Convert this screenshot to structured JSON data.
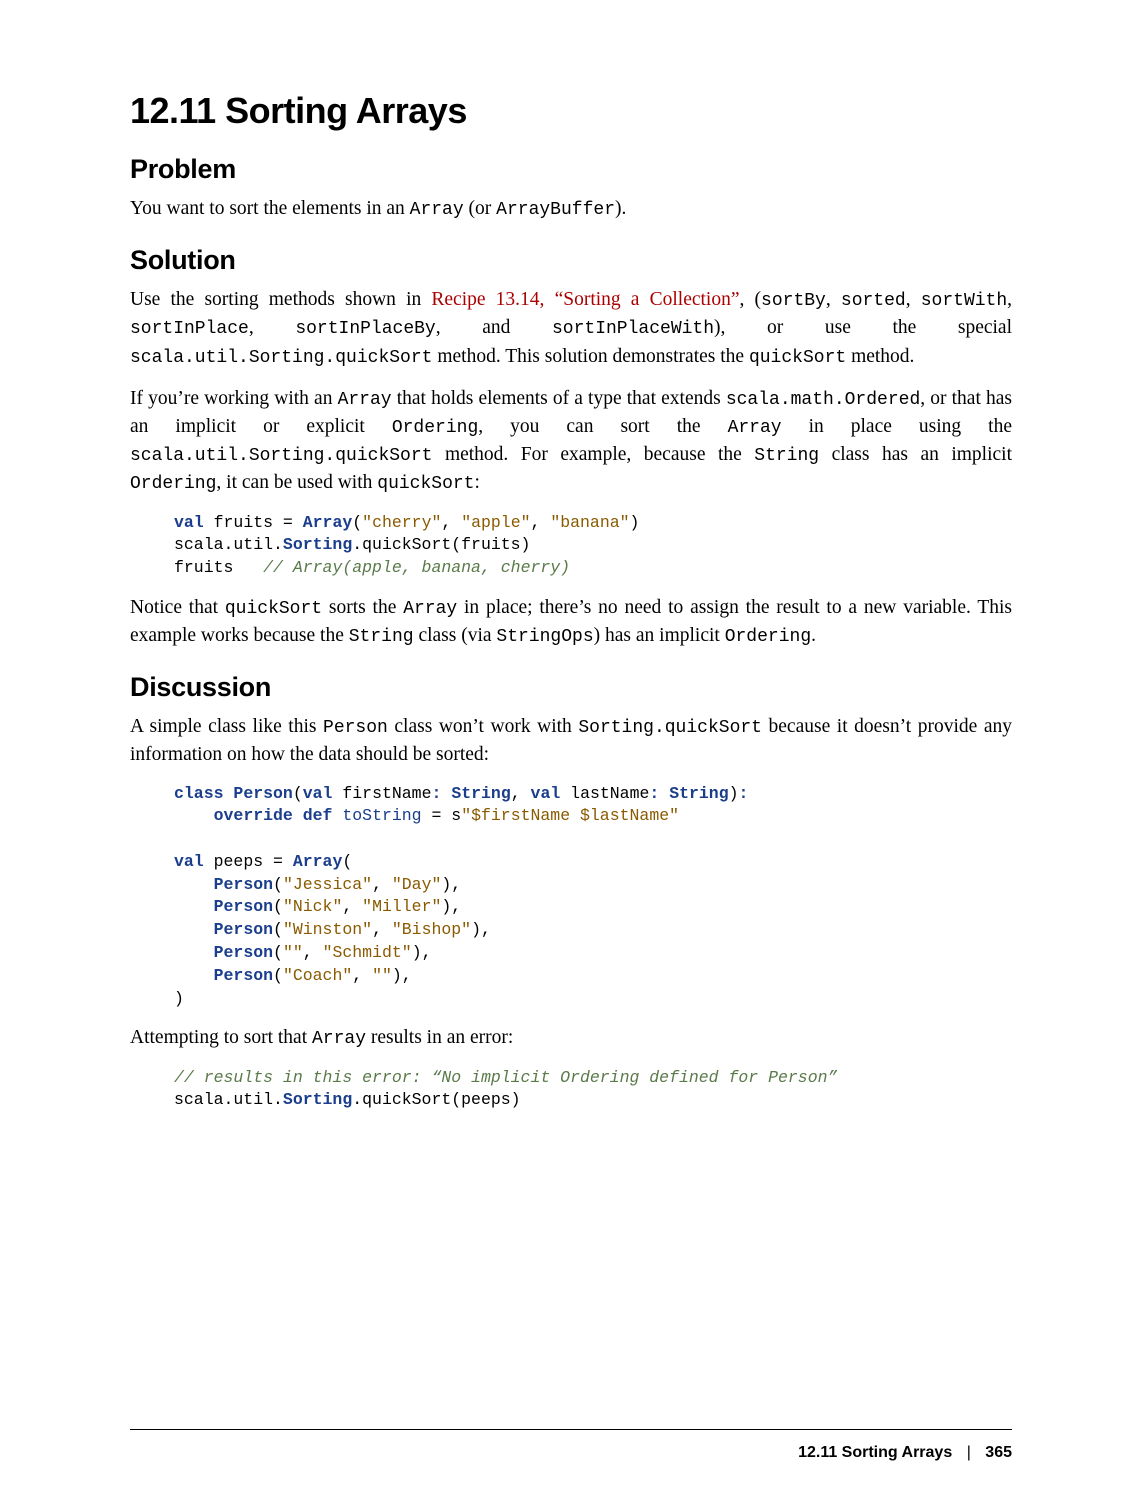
{
  "title": "12.11 Sorting Arrays",
  "sections": {
    "problem": {
      "heading": "Problem",
      "p1_a": "You want to sort the elements in an ",
      "p1_c1": "Array",
      "p1_b": " (or ",
      "p1_c2": "ArrayBuffer",
      "p1_c": ")."
    },
    "solution": {
      "heading": "Solution",
      "p1_a": "Use the sorting methods shown in ",
      "p1_link": "Recipe 13.14, “Sorting a Collection”",
      "p1_b": ", (",
      "p1_c1": "sortBy",
      "p1_c": ", ",
      "p1_c2": "sor",
      "p1_c2b": "ted",
      "p1_d": ", ",
      "p1_c3": "sortWith",
      "p1_e": ", ",
      "p1_c4": "sortInPlace",
      "p1_f": ", ",
      "p1_c5": "sortInPlaceBy",
      "p1_g": ", and ",
      "p1_c6": "sortInPlaceWith",
      "p1_h": "), or use the special ",
      "p1_c7": "scala.util.Sorting.quickSort",
      "p1_i": " method. This solution demonstrates the ",
      "p1_c8": "quick",
      "p1_c8b": "Sort",
      "p1_j": " method.",
      "p2_a": "If you’re working with an ",
      "p2_c1": "Array",
      "p2_b": " that holds elements of a type that extends ",
      "p2_c2": "scala.math.Ordered",
      "p2_c": ", or that has an implicit or explicit ",
      "p2_c3": "Ordering",
      "p2_d": ", you can sort the ",
      "p2_c4": "Array",
      "p2_e": " in place using the ",
      "p2_c5": "scala.util.Sorting.quickSort",
      "p2_f": " method. For example, because the ",
      "p2_c6": "String",
      "p2_g": " class has an implicit ",
      "p2_c7": "Ordering",
      "p2_h": ", it can be used with ",
      "p2_c8": "quickSort",
      "p2_i": ":",
      "code1": {
        "l1_kw": "val",
        "l1_a": " fruits = ",
        "l1_tp": "Array",
        "l1_b": "(",
        "l1_s1": "\"cherry\"",
        "l1_c": ", ",
        "l1_s2": "\"apple\"",
        "l1_d": ", ",
        "l1_s3": "\"banana\"",
        "l1_e": ")",
        "l2_a": "scala.util.",
        "l2_tp": "Sorting",
        "l2_b": ".quickSort(fruits)",
        "l3_a": "fruits   ",
        "l3_cm": "// Array(apple, banana, cherry)"
      },
      "p3_a": "Notice that ",
      "p3_c1": "quickSort",
      "p3_b": " sorts the ",
      "p3_c2": "Array",
      "p3_c": " in place; there’s no need to assign the result to a new variable. This example works because the ",
      "p3_c3": "String",
      "p3_d": " class (via ",
      "p3_c4": "StringOps",
      "p3_e": ") has an implicit ",
      "p3_c5": "Ordering",
      "p3_f": "."
    },
    "discussion": {
      "heading": "Discussion",
      "p1_a": "A simple class like this ",
      "p1_c1": "Person",
      "p1_b": " class won’t work with ",
      "p1_c2": "Sorting.quickSort",
      "p1_c": " because it doesn’t provide any information on how the data should be sorted:",
      "code2": {
        "l1_kw1": "class",
        "l1_a": " ",
        "l1_tp1": "Person",
        "l1_b": "(",
        "l1_kw2": "val",
        "l1_c": " firstName",
        "l1_op1": ":",
        "l1_d": " ",
        "l1_tp2": "String",
        "l1_e": ", ",
        "l1_kw3": "val",
        "l1_f": " lastName",
        "l1_op2": ":",
        "l1_g": " ",
        "l1_tp3": "String",
        "l1_h": ")",
        "l1_op3": ":",
        "l2_ind": "    ",
        "l2_kw1": "override",
        "l2_a": " ",
        "l2_kw2": "def",
        "l2_b": " ",
        "l2_mn": "toString",
        "l2_c": " = s",
        "l2_s": "\"$firstName $lastName\"",
        "l4_kw": "val",
        "l4_a": " peeps = ",
        "l4_tp": "Array",
        "l4_b": "(",
        "p_ind": "    ",
        "p_tp": "Person",
        "p1_a": "(",
        "p1_s1": "\"Jessica\"",
        "p1_b": ", ",
        "p1_s2": "\"Day\"",
        "p1_c": "),",
        "p2_a": "(",
        "p2_s1": "\"Nick\"",
        "p2_b": ", ",
        "p2_s2": "\"Miller\"",
        "p2_c": "),",
        "p3_a": "(",
        "p3_s1": "\"Winston\"",
        "p3_b": ", ",
        "p3_s2": "\"Bishop\"",
        "p3_c": "),",
        "p4_a": "(",
        "p4_s1": "\"\"",
        "p4_b": ", ",
        "p4_s2": "\"Schmidt\"",
        "p4_c": "),",
        "p5_a": "(",
        "p5_s1": "\"Coach\"",
        "p5_b": ", ",
        "p5_s2": "\"\"",
        "p5_c": "),",
        "lend": ")"
      },
      "p2_a": "Attempting to sort that ",
      "p2_c1": "Array",
      "p2_b": " results in an error:",
      "code3": {
        "l1_cm": "// results in this error: “No implicit Ordering defined for Person”",
        "l2_a": "scala.util.",
        "l2_tp": "Sorting",
        "l2_b": ".quickSort(peeps)"
      }
    }
  },
  "footer": {
    "section": "12.11 Sorting Arrays",
    "sep": "|",
    "page": "365"
  }
}
